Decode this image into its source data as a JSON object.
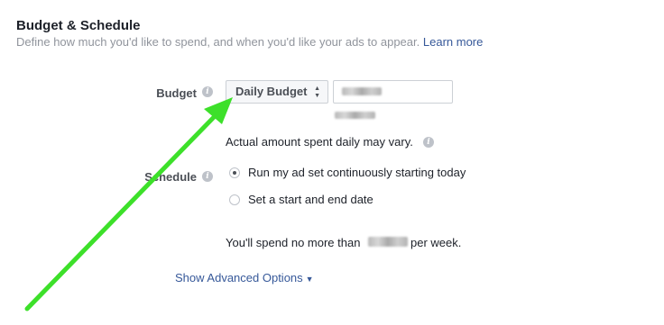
{
  "section": {
    "title": "Budget & Schedule",
    "description": "Define how much you'd like to spend, and when you'd like your ads to appear.",
    "learn_more": "Learn more"
  },
  "budget": {
    "label": "Budget",
    "type_selected": "Daily Budget",
    "note": "Actual amount spent daily may vary."
  },
  "schedule": {
    "label": "Schedule",
    "options": [
      {
        "label": "Run my ad set continuously starting today",
        "checked": true
      },
      {
        "label": "Set a start and end date",
        "checked": false
      }
    ]
  },
  "spend_summary": {
    "prefix": "You'll spend no more than",
    "suffix": "per week."
  },
  "advanced": {
    "label": "Show Advanced Options"
  },
  "colors": {
    "link": "#365899",
    "annotation_arrow": "#3de02a"
  },
  "icons": {
    "info": "info-icon",
    "select_caret": "sort-caret-icon",
    "dropdown": "triangle-down-icon"
  }
}
